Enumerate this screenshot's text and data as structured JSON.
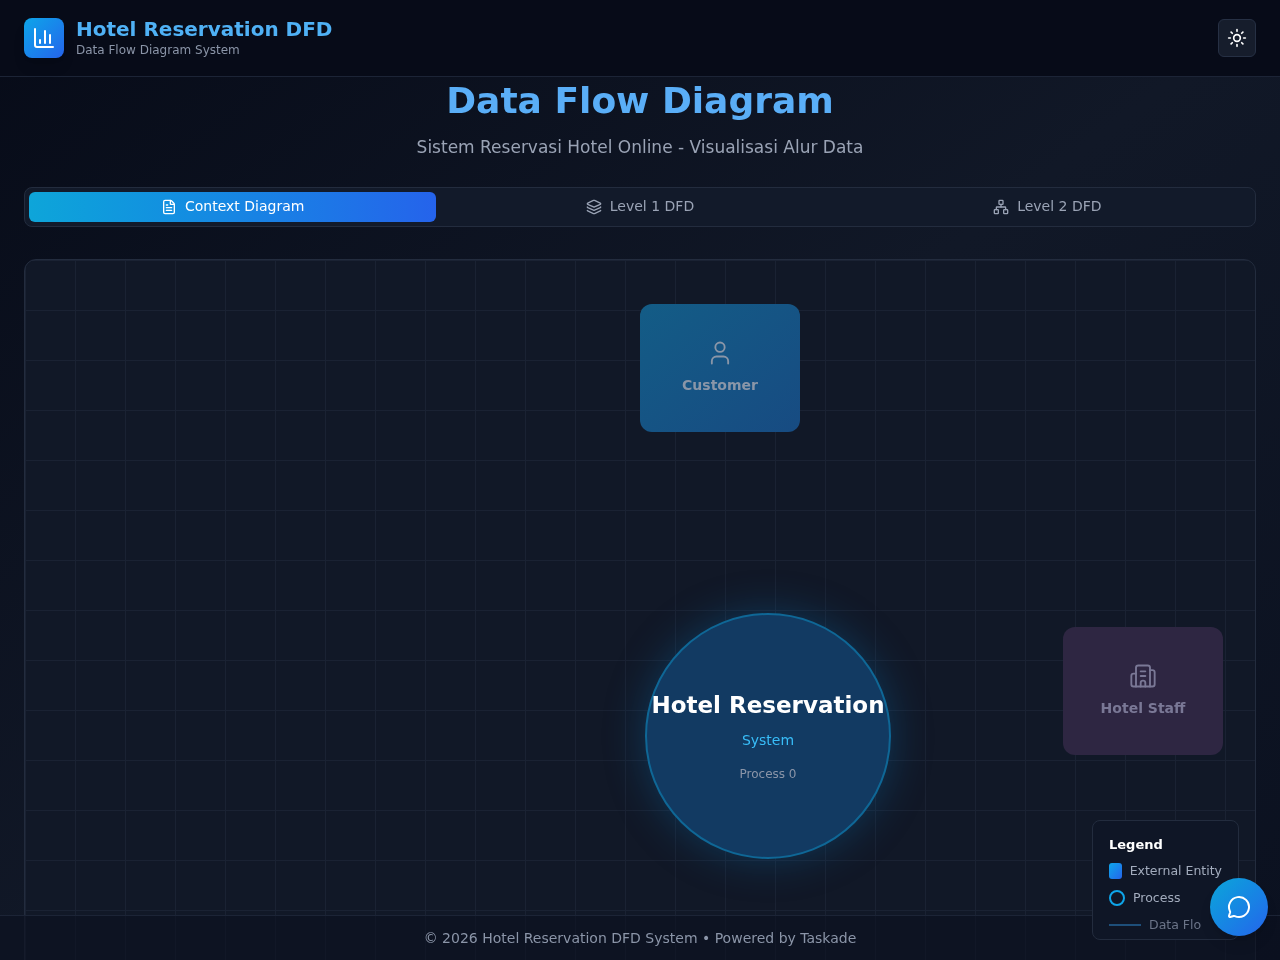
{
  "header": {
    "title": "Hotel Reservation DFD",
    "subtitle": "Data Flow Diagram System"
  },
  "page": {
    "title": "Data Flow Diagram",
    "subtitle": "Sistem Reservasi Hotel Online - Visualisasi Alur Data"
  },
  "tabs": [
    {
      "label": "Context Diagram",
      "kind": "document",
      "selected": true
    },
    {
      "label": "Level 1 DFD",
      "kind": "layers",
      "selected": false
    },
    {
      "label": "Level 2 DFD",
      "kind": "hierarchy",
      "selected": false
    }
  ],
  "diagram": {
    "entities": [
      {
        "label": "Customer",
        "kind": "person",
        "dimmed": false
      },
      {
        "label": "Hotel Staff",
        "kind": "building",
        "dimmed": true
      }
    ],
    "process": {
      "title": "Hotel Reservation",
      "subtitle": "System",
      "number": "Process 0"
    },
    "legend": {
      "title": "Legend",
      "items": [
        {
          "label": "External Entity",
          "kind": "entity"
        },
        {
          "label": "Process",
          "kind": "process"
        },
        {
          "label": "Data Flo",
          "kind": "flow"
        }
      ]
    }
  },
  "footer": "© 2026 Hotel Reservation DFD System • Powered by Taskade"
}
